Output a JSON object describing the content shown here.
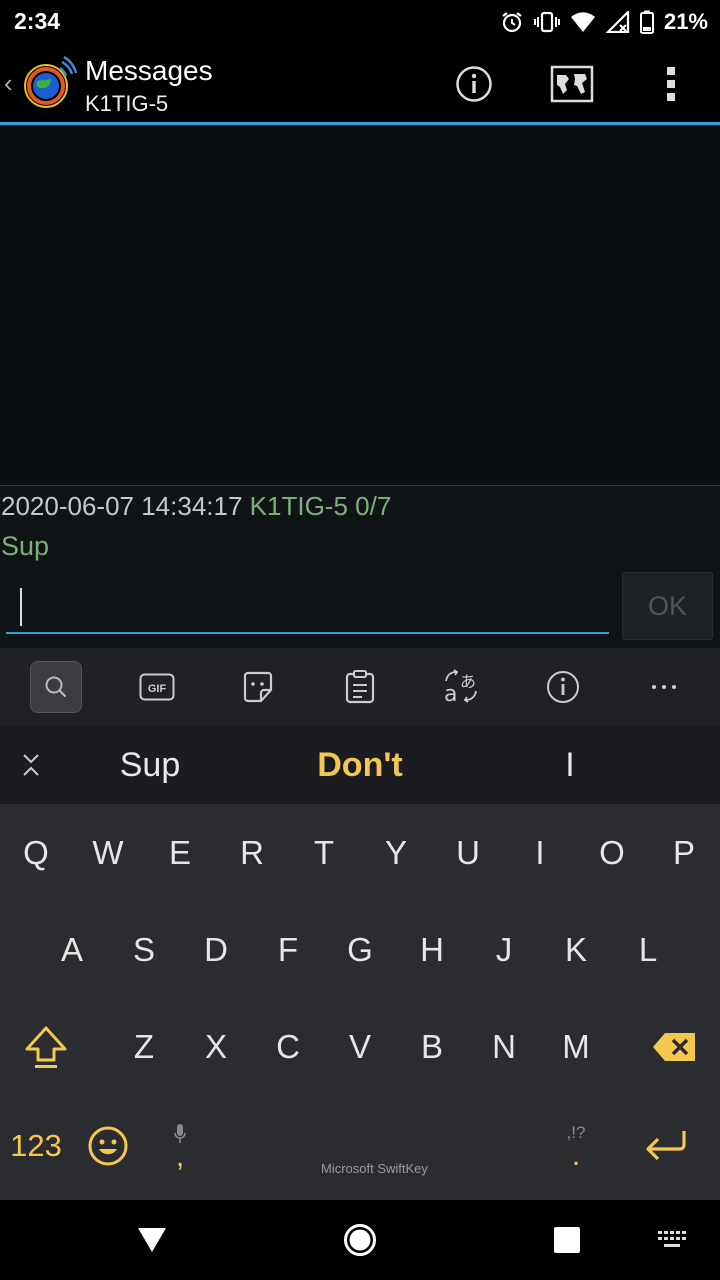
{
  "status": {
    "time": "2:34",
    "battery": "21%"
  },
  "appbar": {
    "back": "‹",
    "title": "Messages",
    "subtitle": "K1TIG-5"
  },
  "message": {
    "timestamp": "2020-06-07 14:34:17",
    "callsign_seq": "K1TIG-5 0/7",
    "text": "Sup"
  },
  "compose": {
    "input_value": "",
    "ok_label": "OK"
  },
  "keyboard": {
    "toolbar": [
      "search-icon",
      "gif-icon",
      "sticker-icon",
      "clipboard-icon",
      "translate-icon",
      "info-icon",
      "more-icon"
    ],
    "suggestions": [
      "Sup",
      "Don't",
      "I"
    ],
    "row1": [
      "Q",
      "W",
      "E",
      "R",
      "T",
      "Y",
      "U",
      "I",
      "O",
      "P"
    ],
    "row2": [
      "A",
      "S",
      "D",
      "F",
      "G",
      "H",
      "J",
      "K",
      "L"
    ],
    "row3": [
      "Z",
      "X",
      "C",
      "V",
      "B",
      "N",
      "M"
    ],
    "mode_label": "123",
    "comma": ",",
    "period": ".",
    "punct_hint": ",!?",
    "brand": "Microsoft SwiftKey"
  },
  "colors": {
    "accent_blue": "#2f9fd6",
    "callsign_green": "#7bb07a",
    "swiftkey_yellow": "#f4c84f"
  }
}
